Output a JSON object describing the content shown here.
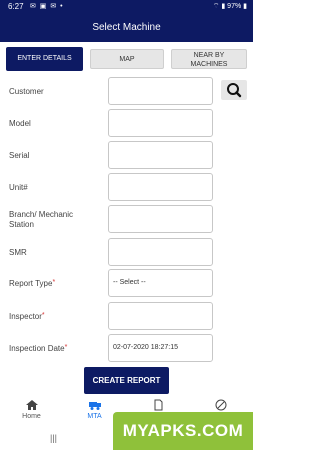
{
  "status_bar": {
    "time": "6:27",
    "notification_icons": "✉ ▣ ✉ •",
    "right_text": "⌔ ▮ 97% ▮",
    "background": "#0d1a63"
  },
  "app_bar": {
    "title": "Select Machine"
  },
  "tabs": {
    "enter_details": "ENTER DETAILS",
    "map": "MAP",
    "near_by": "NEAR BY\nMACHINES"
  },
  "form": {
    "customer_label": "Customer",
    "model_label": "Model",
    "serial_label": "Serial",
    "unit_label": "Unit#",
    "branch_label": "Branch/ Mechanic\nStation",
    "smr_label": "SMR",
    "report_type_label": "Report Type",
    "report_type_value": "-- Select --",
    "inspector_label": "Inspector",
    "inspection_date_label": "Inspection Date",
    "inspection_date_value": "02-07-2020 18:27:15",
    "required_mark": "*"
  },
  "create_button": "CREATE REPORT",
  "bottom_nav": {
    "home": "Home",
    "mta": "MTA"
  },
  "watermark": "MYAPKS.COM",
  "colors": {
    "primary": "#0d1a63",
    "accent": "#1a73e8",
    "required": "#d32f2f",
    "watermark": "#8fc13a"
  }
}
